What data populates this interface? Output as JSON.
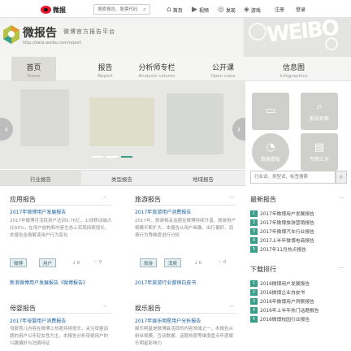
{
  "top": {
    "logo_text": "微报",
    "search_placeholder": "搜索报告、股票代码",
    "nav": [
      {
        "icon": "home-icon",
        "label": "首页"
      },
      {
        "icon": "video-icon",
        "label": "视频"
      },
      {
        "icon": "discover-icon",
        "label": "发现"
      },
      {
        "icon": "game-icon",
        "label": "游戏"
      }
    ],
    "register": "注册",
    "login": "登录"
  },
  "brand": {
    "title": "微报告",
    "slogan": "微博官方报告平台",
    "url": "http://data.weibo.com/report",
    "art_text": "WEIBO"
  },
  "tabs": [
    {
      "zh": "首页",
      "en": "Home"
    },
    {
      "zh": "报告",
      "en": "Report"
    },
    {
      "zh": "分析师专栏",
      "en": "Analysts column"
    },
    {
      "zh": "公开课",
      "en": "Open class"
    },
    {
      "zh": "信息图",
      "en": "Infographics"
    }
  ],
  "tiles": [
    {
      "icon": "bookmark-icon",
      "label": ""
    },
    {
      "icon": "search-doc-icon",
      "label": "报告检索"
    },
    {
      "icon": "chart-icon",
      "label": "数据看板"
    },
    {
      "icon": "book-icon",
      "label": "专题汇总"
    }
  ],
  "subtabs": [
    "行业报告",
    "类型报告",
    "地域报告"
  ],
  "search2_placeholder": "行业词、类型词、标签搜索",
  "sections": [
    {
      "title": "应用报告",
      "more": "···",
      "item_title": "2017年微博用户发展报告",
      "desc": "2017年微博月活跃用户达到3.76亿，上线移动端占比93%，在用户结构和内容生态上实现持续增长，本报告全面解读用户行为变化",
      "btn1": "微博",
      "btn2": "用户",
      "downloads": "0",
      "likes": "0",
      "link": "新浪微博用户发展报告《微博报告》"
    },
    {
      "title": "旅游报告",
      "more": "···",
      "item_title": "2017年旅游用户消费报告",
      "desc": "2017年，旅游相关话题在微博持续升温，旅游用户规模不断扩大，本报告从用户画像、出行偏好、消费行为等维度进行分析",
      "btn1": "旅游",
      "btn2": "消费",
      "downloads": "0",
      "likes": "0",
      "link": "2017年旅游行业营销白皮书"
    },
    {
      "title": "母婴报告",
      "more": "···",
      "item_title": "2017年母婴用户消费报告",
      "desc": "母婴育儿内容在微博上热度持续增长，关注母婴话题的用户以年轻女性为主，本报告分析母婴用户的兴趣偏好与消费特征",
      "btn1": "",
      "btn2": "",
      "downloads": "",
      "likes": "",
      "link": ""
    },
    {
      "title": "娱乐报告",
      "more": "···",
      "item_title": "2017年娱乐明星用户分析报告",
      "desc": "娱乐明星是微博最活跃的内容领域之一，本报告从粉丝规模、互动数据、话题热度等维度盘点年度娱乐明星影响力",
      "btn1": "",
      "btn2": "",
      "downloads": "",
      "likes": "",
      "link": ""
    }
  ],
  "right": {
    "latest_title": "最新报告",
    "latest_more": "···",
    "latest": [
      "2017年微博用户发展报告",
      "2017年微博旅游营销报告",
      "2017年微博汽车行业报告",
      "2017上半年微博电商报告",
      "2017年11月热点报告"
    ],
    "download_title": "下载排行",
    "download_more": "···",
    "downloads": [
      "2016微博用户发展报告",
      "2016微博企业白皮书",
      "2016年微博用户洞察报告",
      "2016年上半年热门话题报告",
      "2016微博校园行业报告"
    ]
  },
  "colors": {
    "accent": "#3a9d8a",
    "brand_red": "#e6162d"
  }
}
